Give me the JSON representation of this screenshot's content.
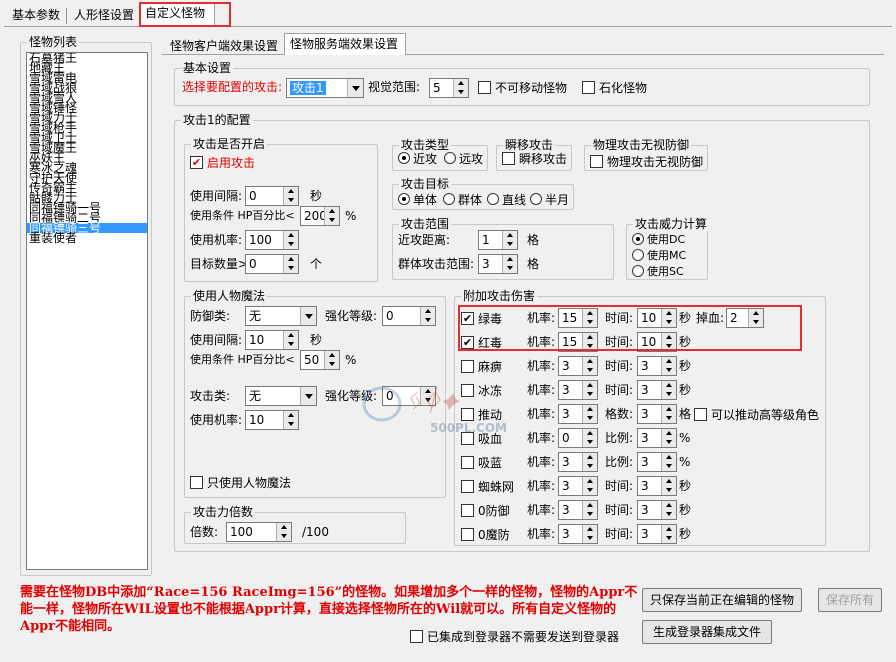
{
  "tabs": {
    "basic": "基本参数",
    "humanoid": "人形怪设置",
    "custom": "自定义怪物"
  },
  "monster_list": {
    "title": "怪物列表",
    "items": [
      "石墓猪王",
      "地藏王",
      "雪域雷电",
      "雪域战狼",
      "雪域雪人",
      "雪域锤怪",
      "雪域力士",
      "雪域枪手",
      "雪域卫士",
      "雪域魔王",
      "巫妖王",
      "寒冰之魂",
      "守护天使",
      "传奇霸主",
      "骷髅力士",
      "同福镖骑一号",
      "同福镖骑二号",
      "同福镖骑三号",
      "重装使者"
    ],
    "selected_index": 17
  },
  "subtabs": {
    "client": "怪物客户端效果设置",
    "server": "怪物服务端效果设置"
  },
  "basic": {
    "title": "基本设置",
    "select_attack_label": "选择要配置的攻击:",
    "select_attack_value": "攻击1",
    "view_range_label": "视觉范围:",
    "view_range_value": "5",
    "immovable_label": "不可移动怪物",
    "petrify_label": "石化怪物"
  },
  "attack1": {
    "title": "攻击1的配置",
    "enabled_group": "攻击是否开启",
    "enable_label": "启用攻击",
    "interval_label": "使用间隔:",
    "interval_value": "0",
    "interval_unit": "秒",
    "cond_label": "使用条件 HP百分比<",
    "cond_value": "200",
    "cond_unit": "%",
    "rate_label": "使用机率:",
    "rate_value": "100",
    "targets_label": "目标数量>",
    "targets_value": "0",
    "targets_unit": "个",
    "type_group": "攻击类型",
    "type_near": "近攻",
    "type_far": "远攻",
    "teleport_group": "瞬移攻击",
    "teleport_label": "瞬移攻击",
    "ignore_group": "物理攻击无视防御",
    "ignore_label": "物理攻击无视防御",
    "target_group": "攻击目标",
    "target_single": "单体",
    "target_group_opt": "群体",
    "target_line": "直线",
    "target_half": "半月",
    "range_group": "攻击范围",
    "near_dist_label": "近攻距离:",
    "near_dist_value": "1",
    "near_dist_unit": "格",
    "group_range_label": "群体攻击范围:",
    "group_range_value": "3",
    "group_range_unit": "格",
    "power_group": "攻击威力计算",
    "power_dc": "使用DC",
    "power_mc": "使用MC",
    "power_sc": "使用SC"
  },
  "magic": {
    "title": "使用人物魔法",
    "defense_label": "防御类:",
    "defense_value": "无",
    "enhance1_label": "强化等级:",
    "enhance1_value": "0",
    "interval_label": "使用间隔:",
    "interval_value": "10",
    "interval_unit": "秒",
    "cond_label": "使用条件 HP百分比<",
    "cond_value": "50",
    "cond_unit": "%",
    "attack_label": "攻击类:",
    "attack_value": "无",
    "enhance2_label": "强化等级:",
    "enhance2_value": "0",
    "rate_label": "使用机率:",
    "rate_value": "10",
    "only_label": "只使用人物魔法"
  },
  "multiplier": {
    "title": "攻击力倍数",
    "label": "倍数:",
    "value": "100",
    "unit": "/100"
  },
  "extra": {
    "title": "附加攻击伤害",
    "rate_label": "机率:",
    "rows": [
      {
        "name": "绿毒",
        "checked": "✔",
        "rate": "15",
        "p2_label": "时间:",
        "p2_value": "10",
        "p2_unit": "秒",
        "p3_label": "掉血:",
        "p3_value": "2"
      },
      {
        "name": "红毒",
        "checked": "✔",
        "rate": "15",
        "p2_label": "时间:",
        "p2_value": "10",
        "p2_unit": "秒"
      },
      {
        "name": "麻痹",
        "checked": "",
        "rate": "3",
        "p2_label": "时间:",
        "p2_value": "3",
        "p2_unit": "秒"
      },
      {
        "name": "冰冻",
        "checked": "",
        "rate": "3",
        "p2_label": "时间:",
        "p2_value": "3",
        "p2_unit": "秒"
      },
      {
        "name": "推动",
        "checked": "",
        "rate": "3",
        "p2_label": "格数:",
        "p2_value": "3",
        "p2_unit": "格",
        "extra_label": "可以推动高等级角色"
      },
      {
        "name": "吸血",
        "checked": "",
        "rate": "0",
        "p2_label": "比例:",
        "p2_value": "3",
        "p2_unit": "%"
      },
      {
        "name": "吸蓝",
        "checked": "",
        "rate": "3",
        "p2_label": "比例:",
        "p2_value": "3",
        "p2_unit": "%"
      },
      {
        "name": "蜘蛛网",
        "checked": "",
        "rate": "3",
        "p2_label": "时间:",
        "p2_value": "3",
        "p2_unit": "秒"
      },
      {
        "name": "0防御",
        "checked": "",
        "rate": "3",
        "p2_label": "时间:",
        "p2_value": "3",
        "p2_unit": "秒"
      },
      {
        "name": "0魔防",
        "checked": "",
        "rate": "3",
        "p2_label": "时间:",
        "p2_value": "3",
        "p2_unit": "秒"
      }
    ]
  },
  "note": "需要在怪物DB中添加“Race=156 RaceImg=156”的怪物。如果增加多个一样的怪物，怪物的Appr不能一样，怪物所在WIL设置也不能根据Appr计算，直接选择怪物所在的Wil就可以。所有自定义怪物的Appr不能相同。",
  "buttons": {
    "save_current": "只保存当前正在编辑的怪物",
    "save_all": "保存所有",
    "integrated_label": "已集成到登录器不需要发送到登录器",
    "gen_integration": "生成登录器集成文件"
  },
  "watermark": {
    "site": "500PL.COM"
  }
}
